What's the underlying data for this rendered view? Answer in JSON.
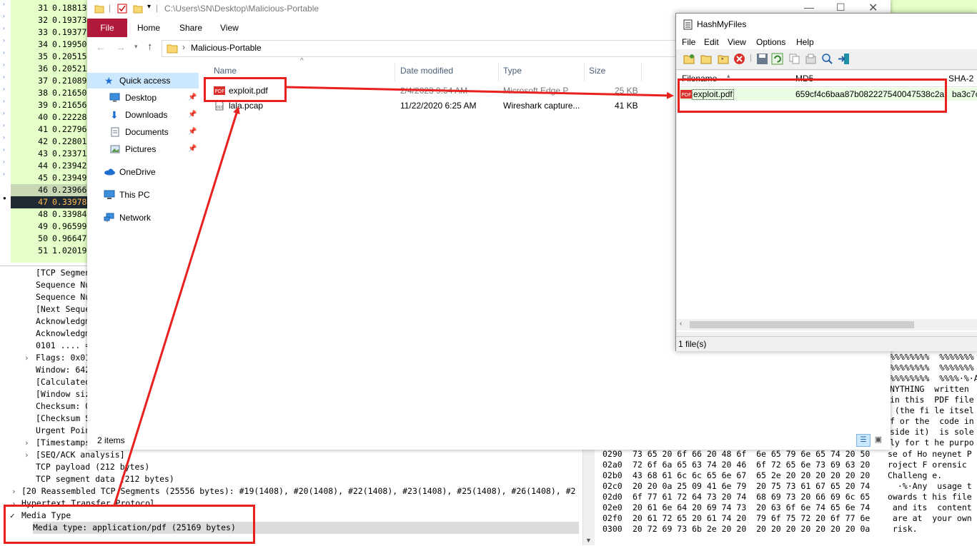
{
  "wireshark": {
    "packet_rows": [
      {
        "no": "31",
        "time": "0.18813"
      },
      {
        "no": "32",
        "time": "0.19373"
      },
      {
        "no": "33",
        "time": "0.19377"
      },
      {
        "no": "34",
        "time": "0.19950"
      },
      {
        "no": "35",
        "time": "0.20515"
      },
      {
        "no": "36",
        "time": "0.20521"
      },
      {
        "no": "37",
        "time": "0.21089"
      },
      {
        "no": "38",
        "time": "0.21650"
      },
      {
        "no": "39",
        "time": "0.21656"
      },
      {
        "no": "40",
        "time": "0.22228"
      },
      {
        "no": "41",
        "time": "0.22796"
      },
      {
        "no": "42",
        "time": "0.22801"
      },
      {
        "no": "43",
        "time": "0.23371"
      },
      {
        "no": "44",
        "time": "0.23942"
      },
      {
        "no": "45",
        "time": "0.23949"
      },
      {
        "no": "46",
        "time": "0.23966"
      },
      {
        "no": "47",
        "time": "0.33978"
      },
      {
        "no": "48",
        "time": "0.33984"
      },
      {
        "no": "49",
        "time": "0.96599"
      },
      {
        "no": "50",
        "time": "0.96647"
      },
      {
        "no": "51",
        "time": "1.02019"
      }
    ],
    "detail_lines": [
      "[TCP Segmen",
      "Sequence Nu",
      "Sequence Nu",
      "[Next Seque",
      "Acknowledgm",
      "Acknowledgm",
      "0101 .... =",
      "Flags: 0x01",
      "Window: 642",
      "[Calculated",
      "[Window siz",
      "Checksum: 0",
      "[Checksum S",
      "Urgent Poin",
      "[Timestamps",
      "[SEQ/ACK analysis]",
      "TCP payload (212 bytes)",
      "TCP segment data (212 bytes)"
    ],
    "reassembled": "[20 Reassembled TCP Segments (25556 bytes): #19(1408), #20(1408), #22(1408), #23(1408), #25(1408), #26(1408), #2",
    "http_line": "Hypertext Transfer Protocol",
    "media_type": "Media Type",
    "media_type_value": "Media type: application/pdf (25169 bytes)",
    "hex_ascii_top": [
      "%%%%%%%%  %%%%%%%",
      "%%%%%%%%  %%%%%%%",
      "%%%%%%%%  %%%%·%·A",
      "NYTHING  written",
      "in this  PDF file",
      " (the fi le itsel",
      "f or the  code in",
      "side it)  is sole",
      "ly for t he purpo"
    ],
    "hex_rows": [
      {
        "off": "0290",
        "hex": "73 65 20 6f 66 20 48 6f  6e 65 79 6e 65 74 20 50",
        "ascii": "se of Ho neynet P"
      },
      {
        "off": "02a0",
        "hex": "72 6f 6a 65 63 74 20 46  6f 72 65 6e 73 69 63 20",
        "ascii": "roject F orensic "
      },
      {
        "off": "02b0",
        "hex": "43 68 61 6c 6c 65 6e 67  65 2e 20 20 20 20 20 20",
        "ascii": "Challeng e."
      },
      {
        "off": "02c0",
        "hex": "20 20 0a 25 09 41 6e 79  20 75 73 61 67 65 20 74",
        "ascii": "  ·%·Any  usage t"
      },
      {
        "off": "02d0",
        "hex": "6f 77 61 72 64 73 20 74  68 69 73 20 66 69 6c 65",
        "ascii": "owards t his file"
      },
      {
        "off": "02e0",
        "hex": "20 61 6e 64 20 69 74 73  20 63 6f 6e 74 65 6e 74",
        "ascii": " and its  content"
      },
      {
        "off": "02f0",
        "hex": "20 61 72 65 20 61 74 20  79 6f 75 72 20 6f 77 6e",
        "ascii": " are at  your own"
      },
      {
        "off": "0300",
        "hex": "20 72 69 73 6b 2e 20 20  20 20 20 20 20 20 20 0a",
        "ascii": " risk."
      }
    ]
  },
  "explorer": {
    "title_path": "C:\\Users\\SN\\Desktop\\Malicious-Portable",
    "ribbon_tabs": [
      "File",
      "Home",
      "Share",
      "View"
    ],
    "breadcrumb": "Malicious-Portable",
    "nav": [
      {
        "label": "Quick access",
        "icon": "star-icon"
      },
      {
        "label": "Desktop",
        "icon": "desktop-icon"
      },
      {
        "label": "Downloads",
        "icon": "download-icon"
      },
      {
        "label": "Documents",
        "icon": "documents-icon"
      },
      {
        "label": "Pictures",
        "icon": "pictures-icon"
      },
      {
        "label": "OneDrive",
        "icon": "cloud-icon"
      },
      {
        "label": "This PC",
        "icon": "pc-icon"
      },
      {
        "label": "Network",
        "icon": "network-icon"
      }
    ],
    "columns": {
      "name": "Name",
      "date": "Date modified",
      "type": "Type",
      "size": "Size"
    },
    "files": [
      {
        "name": "exploit.pdf",
        "date": "2/4/2023 9:54 AM",
        "type": "Microsoft Edge P...",
        "size": "25 KB",
        "icon": "pdf-file-icon"
      },
      {
        "name": "lala.pcap",
        "date": "11/22/2020 6:25 AM",
        "type": "Wireshark capture...",
        "size": "41 KB",
        "icon": "pcap-file-icon"
      }
    ],
    "status": "2 items"
  },
  "hashmyfiles": {
    "title": "HashMyFiles",
    "menu": [
      "File",
      "Edit",
      "View",
      "Options",
      "Help"
    ],
    "columns": {
      "filename": "Filename",
      "md5": "MD5",
      "sha": "SHA-2"
    },
    "row": {
      "filename": "exploit.pdf",
      "md5": "659cf4c6baa87b082227540047538c2a",
      "sha": "ba3c7c"
    },
    "status": "1 file(s)"
  },
  "colors": {
    "annotation_red": "#e8211f",
    "explorer_file_tab": "#b0193a",
    "wireshark_green": "#e4ffc7"
  }
}
